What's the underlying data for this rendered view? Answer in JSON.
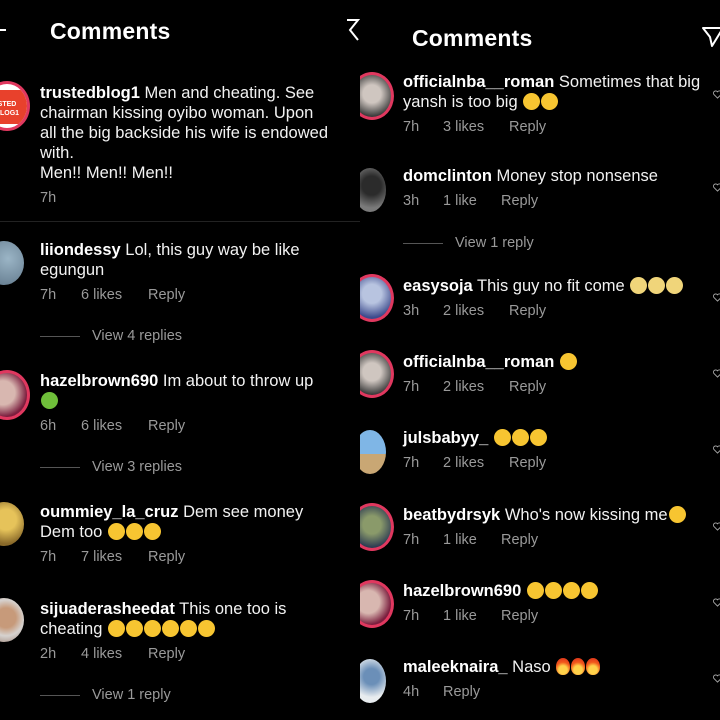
{
  "left": {
    "header_title": "Comments",
    "comments": [
      {
        "user": "trustedblog1",
        "text": "Men and cheating. See chairman kissing oyibo woman. Upon all the big backside his wife is endowed with.",
        "text2": "Men!! Men!! Men!!",
        "time": "7h",
        "likes": "",
        "reply": "",
        "avatar_text": "STED BLOG1"
      },
      {
        "user": "liiondessy",
        "text": "Lol, this guy way be like egungun",
        "time": "7h",
        "likes": "6 likes",
        "reply": "Reply",
        "view": "View 4 replies"
      },
      {
        "user": "hazelbrown690",
        "text": "Im about to throw up",
        "time": "6h",
        "likes": "6 likes",
        "reply": "Reply",
        "view": "View 3 replies"
      },
      {
        "user": "oummiey_la_cruz",
        "text": "Dem see money Dem too",
        "time": "7h",
        "likes": "7 likes",
        "reply": "Reply"
      },
      {
        "user": "sijuaderasheedat",
        "text": "This one too is cheating",
        "time": "2h",
        "likes": "4 likes",
        "reply": "Reply",
        "view": "View 1 reply"
      }
    ]
  },
  "right": {
    "header_title": "Comments",
    "comments": [
      {
        "user": "officialnba__roman",
        "text": "Sometimes that big yansh is too big",
        "time": "7h",
        "likes": "3 likes",
        "reply": "Reply"
      },
      {
        "user": "domclinton",
        "text": "Money stop nonsense",
        "time": "3h",
        "likes": "1 like",
        "reply": "Reply",
        "view": "View 1 reply"
      },
      {
        "user": "easysoja",
        "text": "This guy no fit come",
        "time": "3h",
        "likes": "2 likes",
        "reply": "Reply"
      },
      {
        "user": "officialnba__roman",
        "text": "",
        "time": "7h",
        "likes": "2 likes",
        "reply": "Reply"
      },
      {
        "user": "julsbabyy_",
        "text": "",
        "time": "7h",
        "likes": "2 likes",
        "reply": "Reply"
      },
      {
        "user": "beatbydrsyk",
        "text": "Who's now kissing me",
        "time": "7h",
        "likes": "1 like",
        "reply": "Reply"
      },
      {
        "user": "hazelbrown690",
        "text": "",
        "time": "7h",
        "likes": "1 like",
        "reply": "Reply"
      },
      {
        "user": "maleeknaira_",
        "text": "Naso",
        "time": "4h",
        "likes": "",
        "reply": "Reply"
      }
    ]
  },
  "colors": {
    "background": "#000000",
    "text": "#f5f5f5",
    "meta": "#9a9a9a",
    "story_ring": "#e0385f"
  }
}
